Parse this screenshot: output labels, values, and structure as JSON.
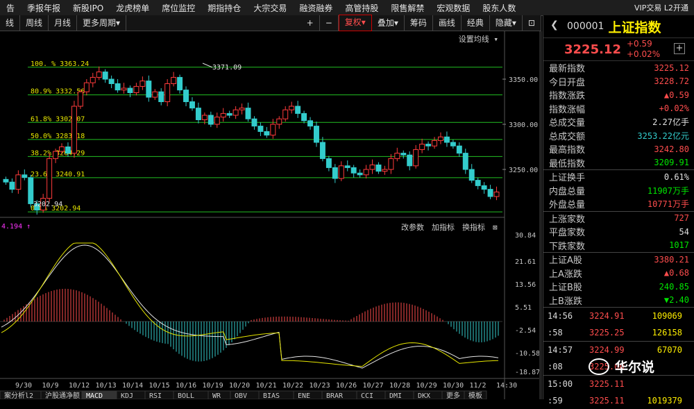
{
  "menu": {
    "items": [
      "告",
      "季报年报",
      "新股IPO",
      "龙虎榜单",
      "席位监控",
      "期指持仓",
      "大宗交易",
      "融资融券",
      "高管持股",
      "限售解禁",
      "宏观数据",
      "股东人数"
    ],
    "vip": "VIP交易",
    "l2": "L2开通"
  },
  "toolbar": {
    "items": [
      "线",
      "周线",
      "月线",
      "更多周期▾"
    ],
    "right": [
      "+",
      "−",
      "复权▾",
      "叠加▾",
      "筹码",
      "画线",
      "经典",
      "隐藏▾",
      "⊡"
    ]
  },
  "chart": {
    "setting": "设置均线 ▾",
    "fib": [
      {
        "label": "100. %  3363.24",
        "v": 3363.24
      },
      {
        "label": "80.9%  3332.56",
        "v": 3332.56
      },
      {
        "label": "61.8%  3302.07",
        "v": 3302.07
      },
      {
        "label": "50.0%  3283.18",
        "v": 3283.18
      },
      {
        "label": "38.2%  3264.29",
        "v": 3264.29
      },
      {
        "label": "23.6%  3240.91",
        "v": 3240.91
      },
      {
        "label": "0.0%  3202.94",
        "v": 3202.94
      }
    ],
    "price_axis": [
      "3350.00",
      "3300.00",
      "3250.00"
    ],
    "high_label": "3371.09",
    "low_label": "3202.94",
    "x_labels": [
      "9/30",
      "10/9",
      "10/12",
      "10/13",
      "10/14",
      "10/15",
      "10/16",
      "10/19",
      "10/20",
      "10/21",
      "10/22",
      "10/23",
      "10/26",
      "10/27",
      "10/28",
      "10/29",
      "10/30",
      "11/2",
      "14:30"
    ],
    "macd_label": "4.194 ↑",
    "macd_tools": [
      "改参数",
      "加指标",
      "换指标",
      "⊠"
    ],
    "macd_axis": [
      "30.84",
      "21.61",
      "13.56",
      "5.51",
      "-2.54",
      "-10.58",
      "-18.87"
    ],
    "bottom_tabs": [
      "案分析l2",
      "沪股通净额",
      "MACD",
      "KDJ",
      "RSI",
      "BOLL",
      "WR",
      "OBV",
      "BIAS",
      "ENE",
      "BRAR",
      "CCI",
      "DMI",
      "DKX",
      "更多",
      "模板"
    ]
  },
  "quote": {
    "code": "000001",
    "name": "上证指数",
    "price": "3225.12",
    "chg": "+0.59",
    "pct": "+0.02%",
    "rows1": [
      [
        "最新指数",
        "3225.12",
        "red"
      ],
      [
        "今日开盘",
        "3228.72",
        "red"
      ],
      [
        "指数涨跌",
        "▲0.59",
        "red"
      ],
      [
        "指数涨幅",
        "+0.02%",
        "red"
      ],
      [
        "总成交量",
        "2.27亿手",
        "white"
      ],
      [
        "总成交额",
        "3253.22亿元",
        "cyan"
      ],
      [
        "最高指数",
        "3242.80",
        "red"
      ],
      [
        "最低指数",
        "3209.91",
        "green"
      ]
    ],
    "rows2": [
      [
        "上证换手",
        "0.61%",
        "white"
      ],
      [
        "内盘总量",
        "11907万手",
        "green"
      ],
      [
        "外盘总量",
        "10771万手",
        "red"
      ]
    ],
    "rows3": [
      [
        "上涨家数",
        "727",
        "red"
      ],
      [
        "平盘家数",
        "54",
        "white"
      ],
      [
        "下跌家数",
        "1017",
        "green"
      ]
    ],
    "rows4": [
      [
        "上证A股",
        "3380.21",
        "red"
      ],
      [
        "上A涨跌",
        "▲0.68",
        "red"
      ],
      [
        "上证B股",
        "240.85",
        "green"
      ],
      [
        "上B涨跌",
        "▼2.40",
        "green"
      ]
    ],
    "ticks": [
      [
        "14:56",
        "3224.91",
        "109069",
        "red"
      ],
      [
        ":58",
        "3225.25",
        "126158",
        "red"
      ],
      [
        "14:57",
        "3224.99",
        "67070",
        "green"
      ],
      [
        ":08",
        "3225.00",
        "",
        "green"
      ],
      [
        "15:00",
        "3225.11",
        "",
        "green"
      ],
      [
        ":59",
        "3225.11",
        "1019379",
        "green"
      ]
    ]
  },
  "watermark": "华尔说"
}
